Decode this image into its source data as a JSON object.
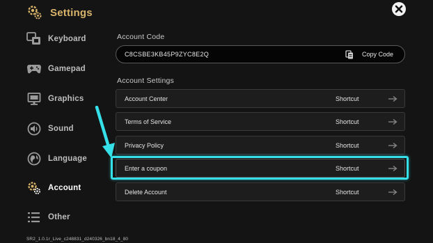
{
  "header": {
    "title": "Settings"
  },
  "sidebar": {
    "items": [
      {
        "label": "Keyboard",
        "icon": "keyboard-icon"
      },
      {
        "label": "Gamepad",
        "icon": "gamepad-icon"
      },
      {
        "label": "Graphics",
        "icon": "monitor-icon"
      },
      {
        "label": "Sound",
        "icon": "speaker-icon"
      },
      {
        "label": "Language",
        "icon": "globe-icon"
      },
      {
        "label": "Account",
        "icon": "account-gear-icon",
        "active": true
      },
      {
        "label": "Other",
        "icon": "list-icon"
      }
    ]
  },
  "account_code": {
    "label": "Account Code",
    "value": "C8CSBE3KB45P9ZYC8E2Q",
    "copy_label": "Copy Code"
  },
  "account_settings": {
    "label": "Account Settings",
    "rows": [
      {
        "label": "Account Center",
        "action": "Shortcut"
      },
      {
        "label": "Terms of Service",
        "action": "Shortcut"
      },
      {
        "label": "Privacy Policy",
        "action": "Shortcut"
      },
      {
        "label": "Enter a coupon",
        "action": "Shortcut",
        "highlighted": true
      },
      {
        "label": "Delete Account",
        "action": "Shortcut"
      }
    ]
  },
  "version": "SR2_1.0.1r_Live_c248831_d240326_bn18_4_80",
  "colors": {
    "accent": "#d9b46a",
    "highlight": "#35e0e8",
    "background": "#141414"
  }
}
